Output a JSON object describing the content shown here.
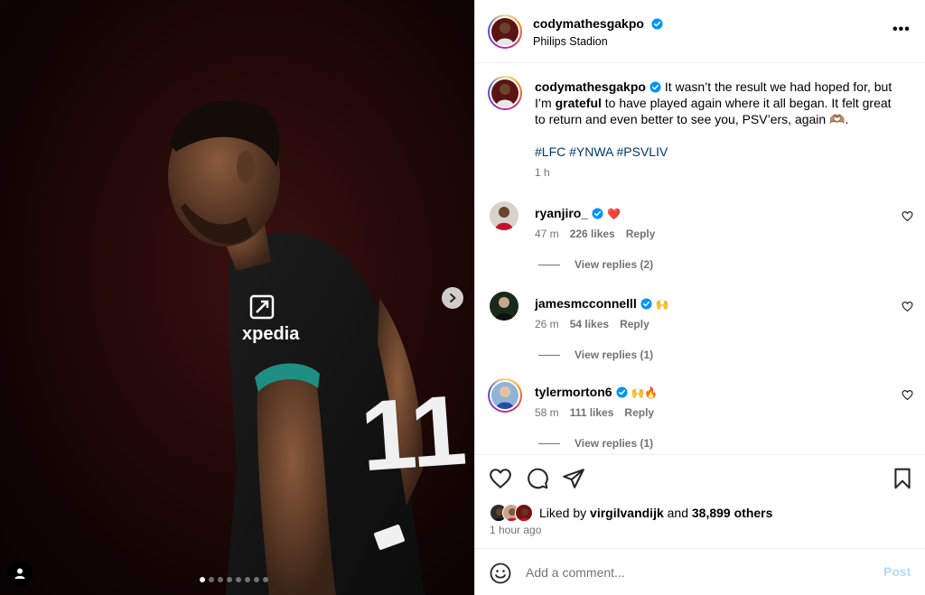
{
  "post": {
    "username": "codymathesgakpo",
    "location": "Philips Stadion",
    "more_label": "•••"
  },
  "media": {
    "carousel_count": 8,
    "carousel_active": 0,
    "next_label": "›",
    "jersey_sponsor": "xpedia",
    "jersey_number": "11"
  },
  "caption": {
    "username": "codymathesgakpo",
    "text_before": "It wasn’t the result we had hoped for, but I’m",
    "bold": "grateful",
    "text_after": "to have played again where it all began. It felt great to return and even better to see you, PSV’ers, again 🫶🏽.",
    "hashtags": "#LFC #YNWA #PSVLIV",
    "time": "1 h"
  },
  "comments": [
    {
      "username": "ryanjiro_",
      "text": "❤️",
      "age": "47 m",
      "likes": "226 likes",
      "reply": "Reply",
      "replies": "View replies (2)"
    },
    {
      "username": "jamesmcconnelll",
      "text": "🙌",
      "age": "26 m",
      "likes": "54 likes",
      "reply": "Reply",
      "replies": "View replies (1)"
    },
    {
      "username": "tylermorton6",
      "text": "🙌🔥",
      "age": "58 m",
      "likes": "111 likes",
      "reply": "Reply",
      "replies": "View replies (1)"
    }
  ],
  "likes": {
    "prefix": "Liked by",
    "user": "virgilvandijk",
    "and": "and",
    "others": "38,899 others",
    "time": "1 hour ago"
  },
  "composer": {
    "placeholder": "Add a comment...",
    "post_label": "Post"
  },
  "colors": {
    "verified": "#0095f6",
    "link": "#00376b",
    "muted": "#737373",
    "post_disabled": "#b3dbff"
  }
}
